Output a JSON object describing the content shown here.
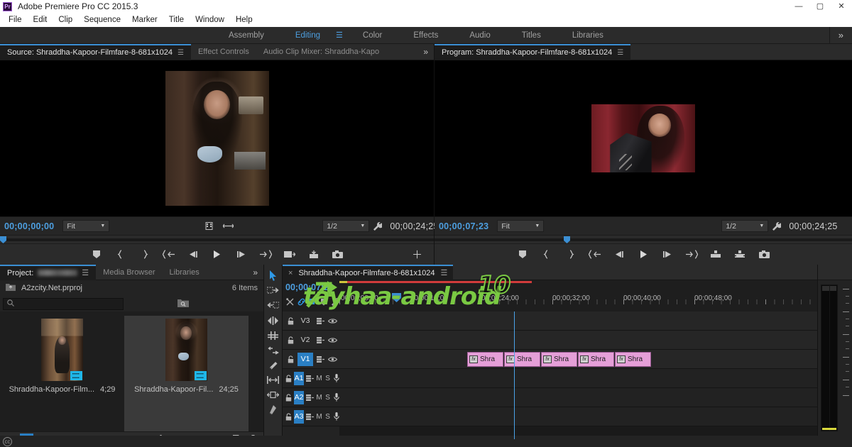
{
  "window": {
    "app_icon": "Pr",
    "title": "Adobe Premiere Pro CC 2015.3",
    "minimize": "—",
    "maximize": "▢",
    "close": "✕"
  },
  "menu": {
    "items": [
      "File",
      "Edit",
      "Clip",
      "Sequence",
      "Marker",
      "Title",
      "Window",
      "Help"
    ]
  },
  "workspace": {
    "tabs": [
      {
        "label": "Assembly",
        "active": false
      },
      {
        "label": "Editing",
        "active": true
      },
      {
        "label": "Color",
        "active": false
      },
      {
        "label": "Effects",
        "active": false
      },
      {
        "label": "Audio",
        "active": false
      },
      {
        "label": "Titles",
        "active": false
      },
      {
        "label": "Libraries",
        "active": false
      }
    ],
    "overflow": "»"
  },
  "source_monitor": {
    "tabs": [
      {
        "label": "Source: Shraddha-Kapoor-Filmfare-8-681x1024",
        "active": true
      },
      {
        "label": "Effect Controls",
        "active": false
      },
      {
        "label": "Audio Clip Mixer: Shraddha-Kapo",
        "active": false
      }
    ],
    "overflow": "»",
    "playhead_timecode": "00;00;00;00",
    "zoom_level": "Fit",
    "resolution": "1/2",
    "duration_timecode": "00;00;24;25"
  },
  "program_monitor": {
    "tab_label": "Program: Shraddha-Kapoor-Filmfare-8-681x1024",
    "playhead_timecode": "00;00;07;23",
    "zoom_level": "Fit",
    "resolution": "1/2",
    "duration_timecode": "00;00;24;25"
  },
  "project_panel": {
    "tabs": [
      {
        "label": "Project:",
        "active": true,
        "redacted": true
      },
      {
        "label": "Media Browser",
        "active": false
      },
      {
        "label": "Libraries",
        "active": false
      }
    ],
    "overflow": "»",
    "project_file": "A2zcity.Net.prproj",
    "item_count": "6 Items",
    "search_placeholder": "",
    "items": [
      {
        "name": "Shraddha-Kapoor-Film...",
        "duration": "4;29",
        "selected": false
      },
      {
        "name": "Shraddha-Kapoor-Fil...",
        "duration": "24;25",
        "selected": true
      }
    ]
  },
  "tools": [
    {
      "name": "selection-tool",
      "active": true
    },
    {
      "name": "track-select-forward-tool",
      "active": false
    },
    {
      "name": "track-select-backward-tool",
      "active": false
    },
    {
      "name": "ripple-edit-tool",
      "active": false
    },
    {
      "name": "rolling-edit-tool",
      "active": false
    },
    {
      "name": "rate-stretch-tool",
      "active": false
    },
    {
      "name": "razor-tool",
      "active": false
    },
    {
      "name": "slip-tool",
      "active": false
    },
    {
      "name": "slide-tool",
      "active": false
    },
    {
      "name": "pen-tool",
      "active": false
    }
  ],
  "timeline": {
    "tab_label": "Shraddha-Kapoor-Filmfare-8-681x1024",
    "close_glyph": "×",
    "menu_glyph": "☰",
    "playhead_timecode": "00;00;07;23",
    "ruler_labels": [
      "00;00;08;00",
      "00;00;16;00",
      "00;00;24;00",
      "00;00;32;00",
      "00;00;40;00",
      "00;00;48;00"
    ],
    "video_tracks": [
      {
        "name": "V3",
        "targeted": false
      },
      {
        "name": "V2",
        "targeted": false
      },
      {
        "name": "V1",
        "targeted": true
      }
    ],
    "audio_tracks": [
      {
        "name": "A1",
        "targeted": true,
        "mute": "M",
        "solo": "S"
      },
      {
        "name": "A2",
        "targeted": true,
        "mute": "M",
        "solo": "S"
      },
      {
        "name": "A3",
        "targeted": true,
        "mute": "M",
        "solo": "S"
      }
    ],
    "clips": [
      {
        "label": "Shra",
        "fx": "fx"
      },
      {
        "label": "Shra",
        "fx": "fx"
      },
      {
        "label": "Shra",
        "fx": "fx"
      },
      {
        "label": "Shra",
        "fx": "fx"
      },
      {
        "label": "Shra",
        "fx": "fx"
      }
    ]
  },
  "watermark": {
    "text": "tayhaa-android",
    "suffix": "10",
    "color": "#7ac943"
  },
  "colors": {
    "accent_blue": "#3b8fd4",
    "timecode_blue": "#4d9fe0",
    "clip_pink": "#e59fd8",
    "panel_bg": "#232323",
    "track_bg": "#262626",
    "watermark_green": "#7ac943"
  }
}
